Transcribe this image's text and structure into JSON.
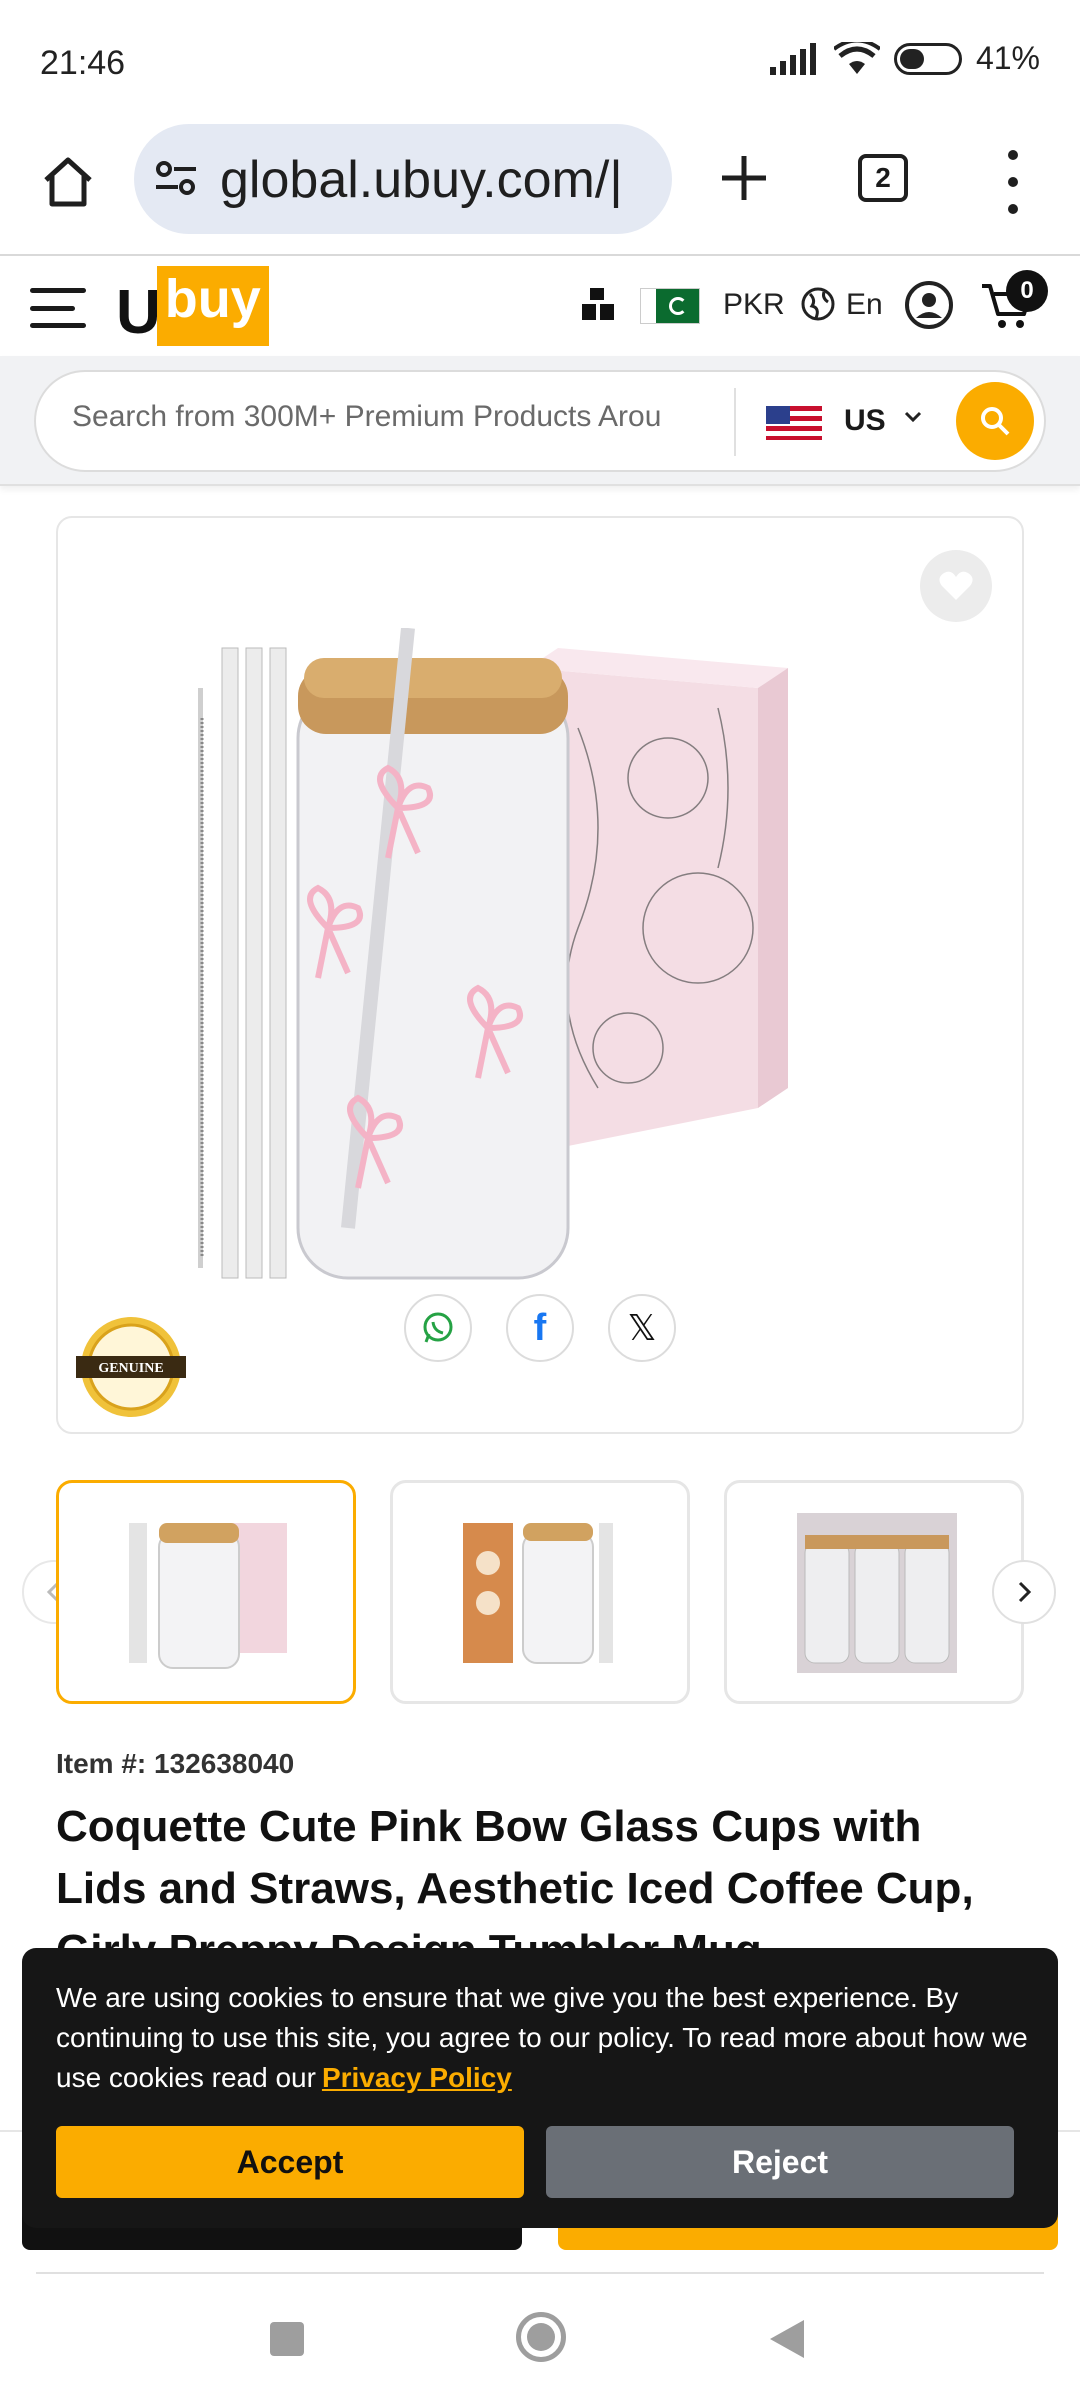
{
  "status_bar": {
    "time": "21:46",
    "battery": "41%"
  },
  "browser": {
    "url": "global.ubuy.com/|",
    "tab_count": "2"
  },
  "header": {
    "logo_u": "U",
    "logo_rest": "buy",
    "currency": "PKR",
    "language": "En",
    "cart_count": "0"
  },
  "search": {
    "placeholder": "Search from 300M+ Premium Products Arou",
    "store": "US"
  },
  "share": {
    "facebook": "f",
    "x": "𝕏"
  },
  "product": {
    "item_label": "Item #:",
    "item_number": "132638040",
    "title": "Coquette Cute Pink Bow Glass Cups with Lids and Straws, Aesthetic Iced Coffee Cup, Girly Preppy Design Tumbler Mug"
  },
  "badge": {
    "text": "GENUINE"
  },
  "cookie": {
    "message": "We are using cookies to ensure that we give you the best experience. By continuing to use this site, you agree to our policy. To read more about how we use cookies read our",
    "link": "Privacy Policy",
    "accept": "Accept",
    "reject": "Reject"
  },
  "colors": {
    "brand": "#fbac00",
    "dark": "#161616",
    "reject": "#6a6f76"
  }
}
